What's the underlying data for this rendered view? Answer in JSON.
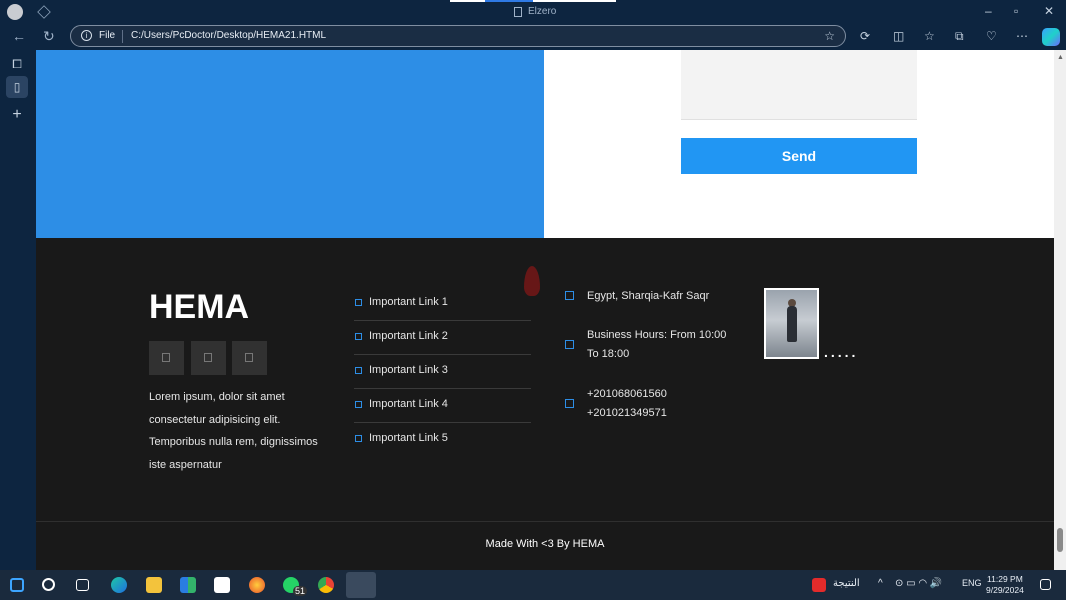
{
  "browser": {
    "tab_title": "Elzero",
    "address_scheme": "File",
    "address_url": "C:/Users/PcDoctor/Desktop/HEMA21.HTML"
  },
  "page": {
    "send_label": "Send",
    "footer": {
      "brand": "HEMA",
      "about": "Lorem ipsum, dolor sit amet consectetur adipisicing elit. Temporibus nulla rem, dignissimos iste aspernatur",
      "links": [
        "Important Link 1",
        "Important Link 2",
        "Important Link 3",
        "Important Link 4",
        "Important Link 5"
      ],
      "contact": {
        "address": "Egypt, Sharqia-Kafr Saqr",
        "hours_line1": "Business Hours: From 10:00",
        "hours_line2": "To 18:00",
        "phone1": "+201068061560",
        "phone2": "+201021349571"
      },
      "dots": ".....",
      "copyright": "Made With <3 By HEMA"
    }
  },
  "taskbar": {
    "whatsapp_badge": "51",
    "search_result_label": "النتيجة",
    "language": "ENG",
    "time": "11:29 PM",
    "date": "9/29/2024"
  },
  "colors": {
    "accent_blue": "#2d8ee6",
    "send_blue": "#2196f3",
    "footer_bg": "#191919"
  }
}
